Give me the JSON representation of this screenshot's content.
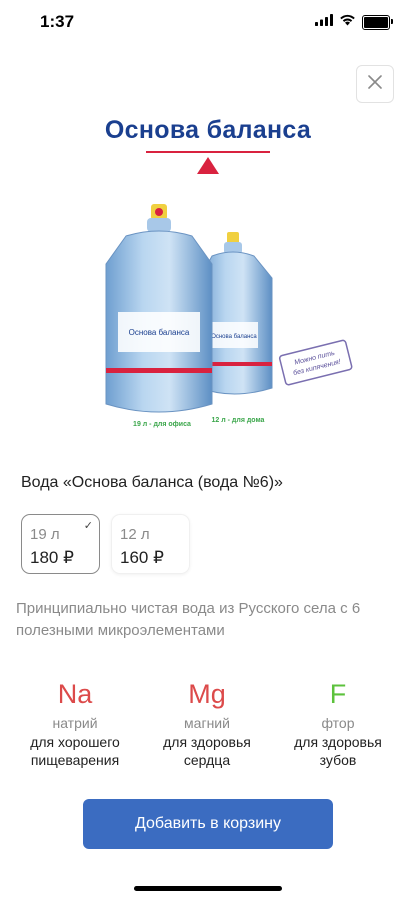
{
  "status_bar": {
    "time": "1:37",
    "icons": [
      "signal-icon",
      "wifi-icon",
      "battery-icon"
    ]
  },
  "close_icon": "close-icon",
  "brand": {
    "title": "Основа баланса",
    "accent_color": "#d9223f",
    "title_color": "#1a3f8f"
  },
  "image": {
    "label_19": "19 л - для офиса",
    "label_12": "12 л - для дома",
    "bottle_label": "Основа баланса",
    "sticker_line1": "Можно пить",
    "sticker_line2": "без кипячения!"
  },
  "product": {
    "title": "Вода «Основа баланса (вода №6)»",
    "options": [
      {
        "volume": "19 л",
        "price": "180 ₽",
        "selected": true
      },
      {
        "volume": "12 л",
        "price": "160 ₽",
        "selected": false
      }
    ],
    "description": "Принципиально чистая вода из Русского села с 6 полезными микроэлементами"
  },
  "minerals": [
    {
      "symbol": "Na",
      "name": "натрий",
      "benefit_line1": "для хорошего",
      "benefit_line2": "пищеварения",
      "color": "#dc4a4a"
    },
    {
      "symbol": "Mg",
      "name": "магний",
      "benefit_line1": "для здоровья",
      "benefit_line2": "сердца",
      "color": "#dc4a4a"
    },
    {
      "symbol": "F",
      "name": "фтор",
      "benefit_line1": "для здоровья",
      "benefit_line2": "зубов",
      "color": "#5cc23c"
    }
  ],
  "add_button": {
    "label": "Добавить в корзину",
    "color": "#3b6cc1"
  }
}
